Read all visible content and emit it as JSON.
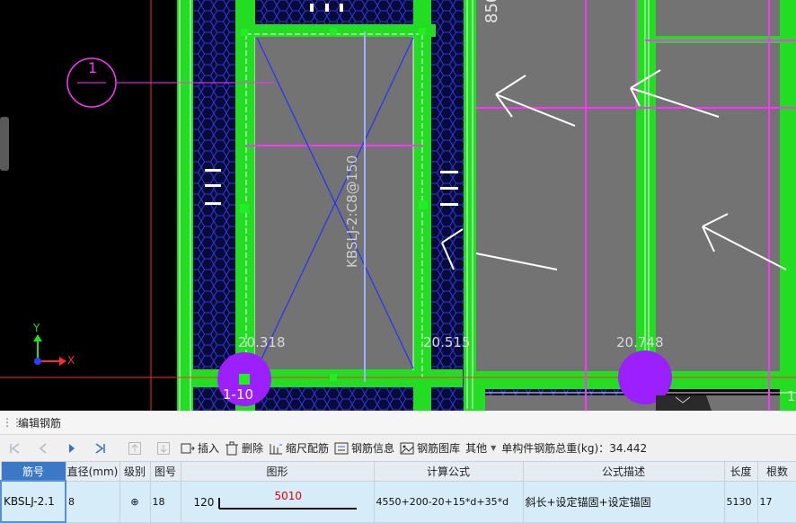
{
  "canvas": {
    "labels": {
      "dim_top": "850",
      "rebar_label": "KBSLJ-2:C8@150",
      "elev_1": "20.318",
      "elev_2": "20.515",
      "elev_3": "20.748",
      "axis_tag": "1-10",
      "axis_y": "Y",
      "axis_x": "X",
      "circle_mark": "1",
      "right_edge_digit": "1"
    }
  },
  "panel": {
    "title": "编辑钢筋",
    "toolbar": {
      "insert": "插入",
      "delete": "删除",
      "scale_rebar": "缩尺配筋",
      "rebar_info": "钢筋信息",
      "rebar_lib": "钢筋图库",
      "other": "其他",
      "total_weight_label": "单构件钢筋总重(kg)：",
      "total_weight_value": "34.442"
    },
    "columns": [
      "筋号",
      "直径(mm)",
      "级别",
      "图号",
      "图形",
      "计算公式",
      "公式描述",
      "长度",
      "根数"
    ],
    "row": {
      "bar_no": "KBSLJ-2.1",
      "diameter": "8",
      "grade": "⊕",
      "figure_no": "18",
      "shape_left": "120",
      "shape_len": "5010",
      "formula": "4550+200-20+15*d+35*d",
      "description": "斜长+设定锚固+设定锚固",
      "length": "5130",
      "count": "17"
    }
  }
}
